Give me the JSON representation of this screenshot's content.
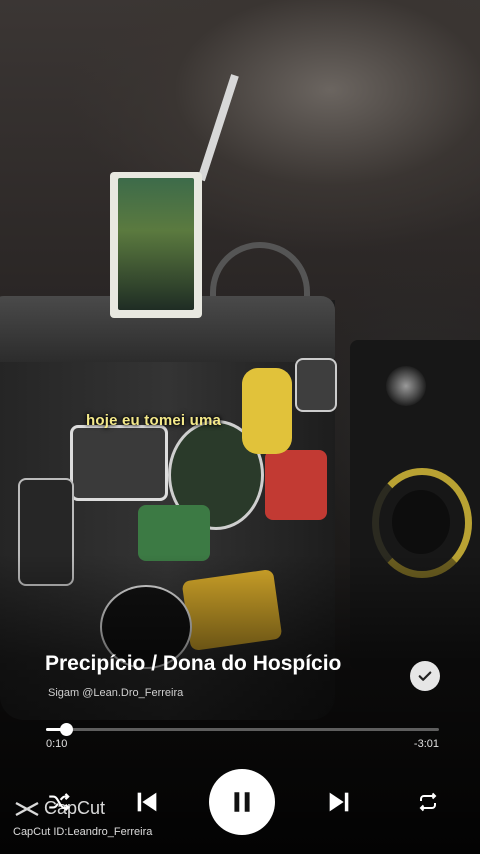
{
  "lyric": "hoje eu tomei uma",
  "track": {
    "title": "Precipício / Dona do Hospício",
    "artist": "Sigam @Lean.Dro_Ferreira",
    "liked": true
  },
  "progress": {
    "elapsed": "0:10",
    "remaining": "-3:01",
    "fraction": 0.052
  },
  "controls": {
    "shuffle_icon": "shuffle-icon",
    "prev_icon": "skip-previous-icon",
    "play_icon": "pause-icon",
    "next_icon": "skip-next-icon",
    "repeat_icon": "repeat-icon"
  },
  "watermark": {
    "brand": "CapCut",
    "id": "CapCut ID:Leandro_Ferreira"
  },
  "colors": {
    "lyric": "#f4e98a",
    "accent": "#ffffff"
  }
}
